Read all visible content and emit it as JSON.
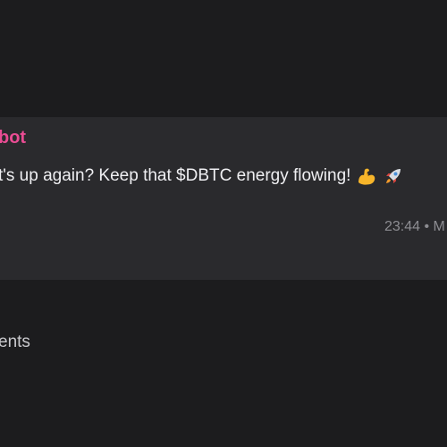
{
  "message": {
    "sender": "bot",
    "text": "t's up again? Keep that $DBTC energy flowing!",
    "emojis": [
      "flexed-biceps-icon",
      "rocket-icon"
    ],
    "meta": "23:44 • M"
  },
  "comments": {
    "label": "ents"
  },
  "colors": {
    "background": "#1c1c1e",
    "card": "#2a2a2d",
    "sender": "#e94c93",
    "text": "#efeff2",
    "meta": "#8d8d92"
  }
}
